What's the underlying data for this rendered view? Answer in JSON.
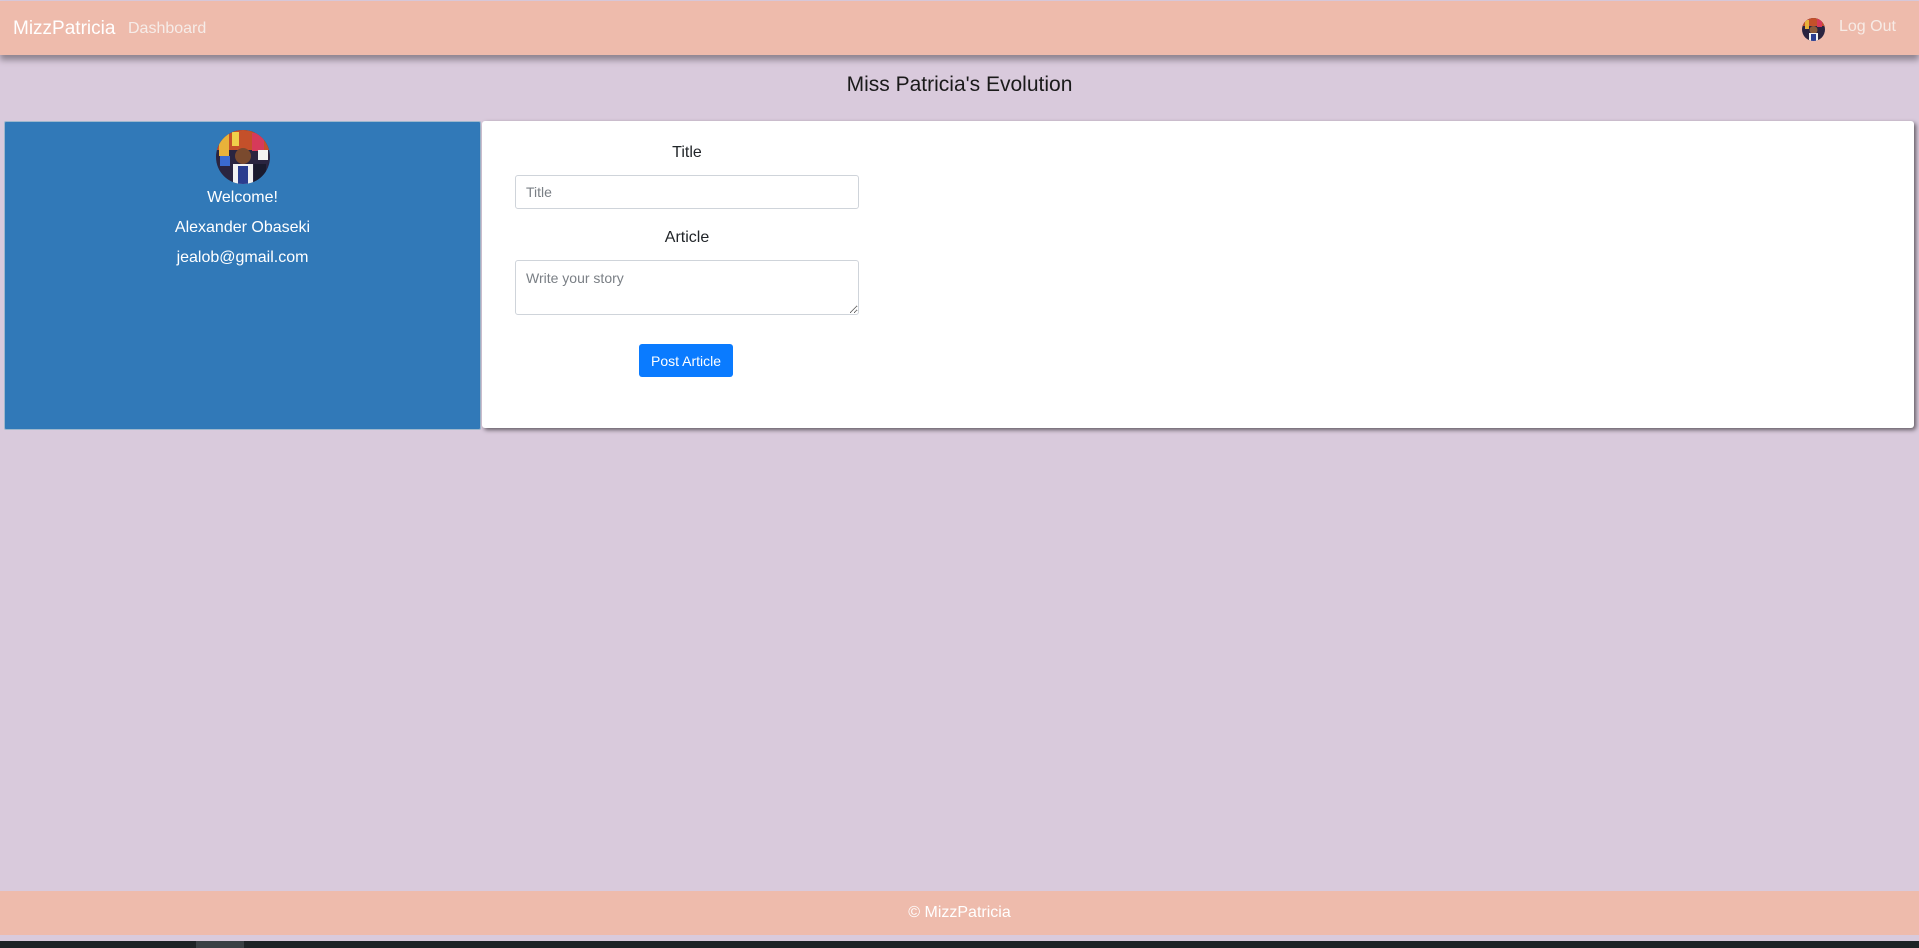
{
  "navbar": {
    "brand": "MizzPatricia",
    "dashboard_label": "Dashboard",
    "logout_label": "Log Out",
    "bg_color": "#eebbac"
  },
  "page": {
    "title": "Miss Patricia's Evolution",
    "bg_color": "#d9cadc"
  },
  "profile": {
    "welcome": "Welcome!",
    "name": "Alexander Obaseki",
    "email": "jealob@gmail.com",
    "bg_color": "#3179b8"
  },
  "article_form": {
    "title_label": "Title",
    "title_placeholder": "Title",
    "title_value": "",
    "article_label": "Article",
    "article_placeholder": "Write your story",
    "article_value": "",
    "submit_label": "Post Article",
    "accent_color": "#0a7bff"
  },
  "footer": {
    "text": "© MizzPatricia"
  }
}
